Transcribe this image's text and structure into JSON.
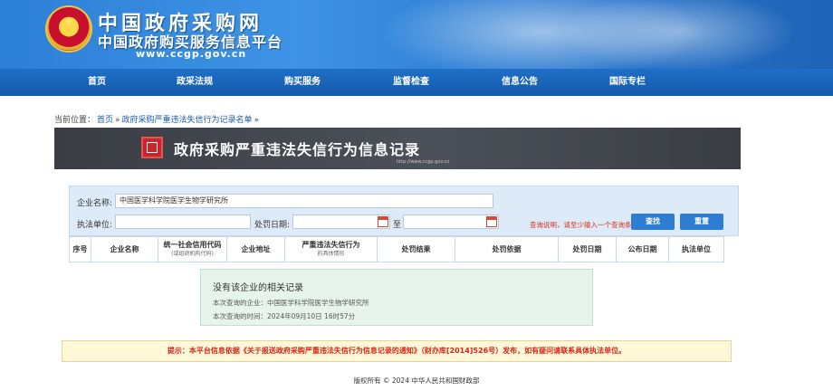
{
  "header": {
    "title_main": "中国政府采购网",
    "title_sub": "中国政府购买服务信息平台",
    "url": "www.ccgp.gov.cn"
  },
  "nav": {
    "items": [
      "首页",
      "政采法规",
      "购买服务",
      "监督检查",
      "信息公告",
      "国际专栏"
    ]
  },
  "breadcrumb": {
    "prefix": "当前位置：",
    "items": [
      "首页",
      "»",
      "政府采购严重违法失信行为记录名单",
      "»"
    ]
  },
  "page_title": {
    "text": "政府采购严重违法失信行为信息记录",
    "url": "http://www.ccgp.gov.cn"
  },
  "search": {
    "company_label": "企业名称:",
    "company_value": "中国医学科学院医学生物学研究所",
    "unit_label": "执法单位:",
    "unit_value": "",
    "date_label": "处罚日期:",
    "date_from": "",
    "date_to_label": "至",
    "date_to": "",
    "hint": "查询说明，请至少输入一个查询条件",
    "search_button": "查找",
    "reset_button": "重置"
  },
  "table": {
    "headers": [
      {
        "label": "序号",
        "sub": ""
      },
      {
        "label": "企业名称",
        "sub": ""
      },
      {
        "label": "统一社会信用代码",
        "sub": "(或组织机构代码)"
      },
      {
        "label": "企业地址",
        "sub": ""
      },
      {
        "label": "严重违法失信行为",
        "sub": "的具体情形"
      },
      {
        "label": "处罚结果",
        "sub": ""
      },
      {
        "label": "处罚依据",
        "sub": ""
      },
      {
        "label": "处罚日期",
        "sub": ""
      },
      {
        "label": "公布日期",
        "sub": ""
      },
      {
        "label": "执法单位",
        "sub": ""
      }
    ]
  },
  "result": {
    "message": "没有该企业的相关记录",
    "query_company": "本次查询的企业：中国医学科学院医学生物学研究所",
    "query_time": "本次查询的时间：2024年09月10日 16时57分"
  },
  "notice": {
    "text": "提示：本平台信息依据《关于报送政府采购严重违法失信行为信息记录的通知》（财办库[2014]526号）发布，如有疑问请联系具体执法单位。"
  },
  "footer": {
    "text": "版权所有 © 2024 中华人民共和国财政部"
  },
  "colors": {
    "banner_blue": "#2b7fd6",
    "nav_blue": "#1559ab",
    "title_bar": "#4c5058",
    "search_bg": "#dcebf7",
    "button_blue": "#2e7dd1",
    "notice_red": "#d0281d"
  }
}
